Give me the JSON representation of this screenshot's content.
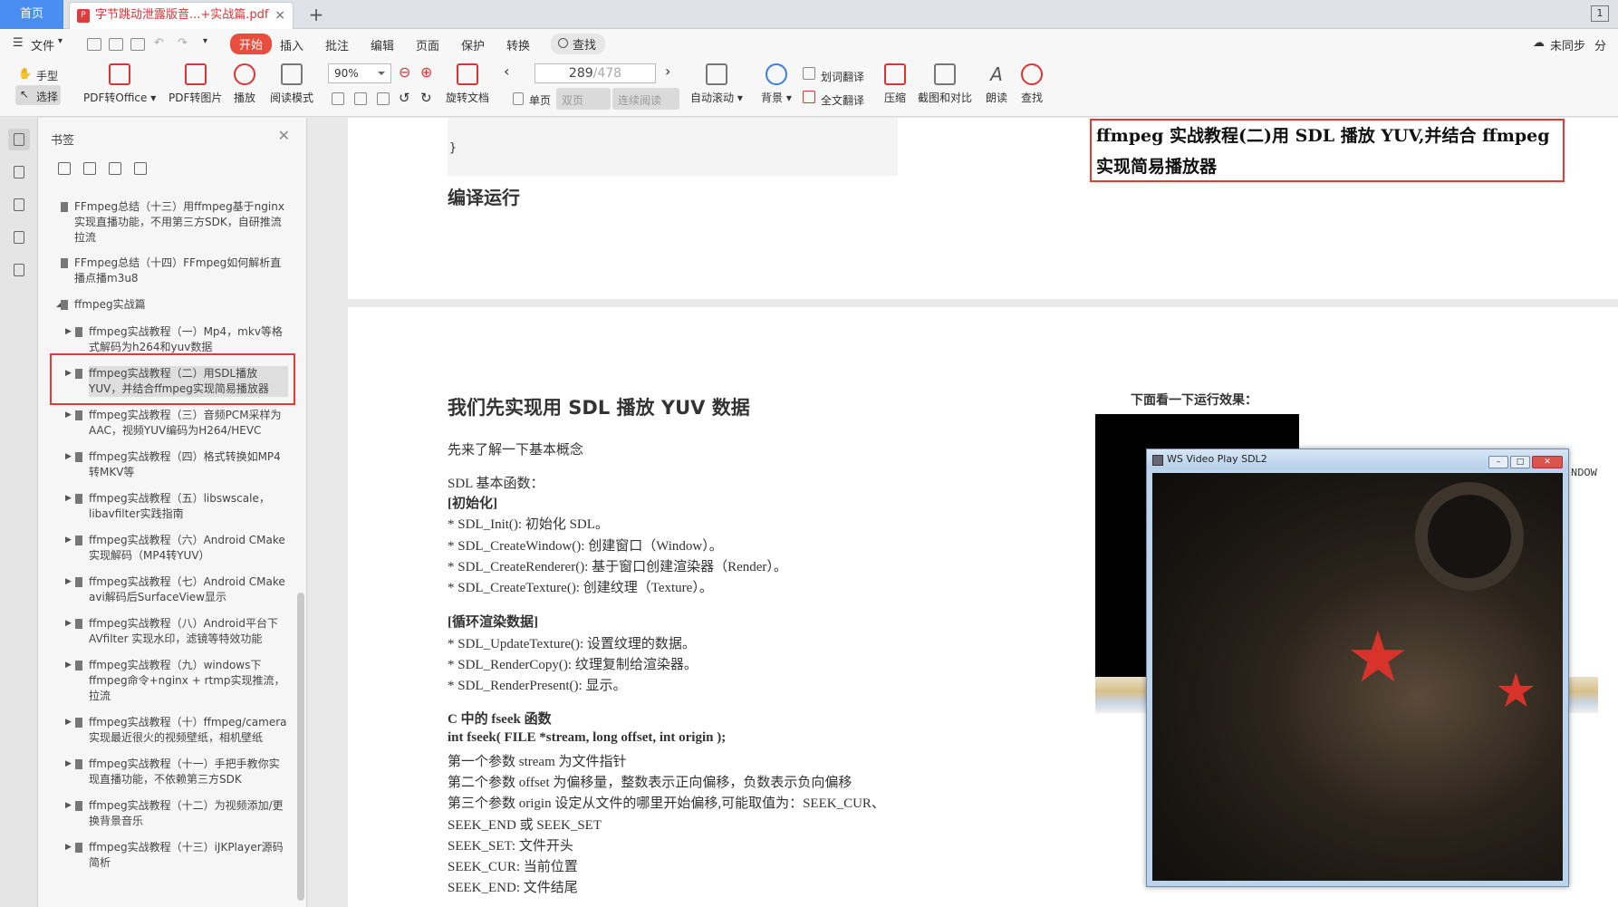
{
  "tabs": {
    "home": "首页",
    "doc": "字节跳动泄露版音...+实战篇.pdf"
  },
  "menu": [
    "文件",
    "开始",
    "插入",
    "批注",
    "编辑",
    "页面",
    "保护",
    "转换",
    "查找"
  ],
  "sync": {
    "unsynced": "未同步",
    "share": "分"
  },
  "tools": {
    "hand": "手型",
    "select": "选择",
    "pdf2office": "PDF转Office",
    "pdf2img": "PDF转图片",
    "play": "播放",
    "readmode": "阅读模式",
    "zoom": "90%",
    "rotate": "旋转文档",
    "page_current": "289",
    "page_total": "/478",
    "single": "单页",
    "double": "双页",
    "continuous": "连续阅读",
    "autoscroll": "自动滚动",
    "background": "背景",
    "word_translate": "划词翻译",
    "full_translate": "全文翻译",
    "compress": "压缩",
    "screenshot_compare": "截图和对比",
    "read_aloud": "朗读",
    "find": "查找"
  },
  "bookmarks_panel": {
    "title": "书签",
    "items": [
      "FFmpeg总结（十三）用ffmpeg基于nginx实现直播功能，不用第三方SDK，自研推流拉流",
      "FFmpeg总结（十四）FFmpeg如何解析直播点播m3u8",
      "ffmpeg实战篇",
      "ffmpeg实战教程（一）Mp4，mkv等格式解码为h264和yuv数据",
      "ffmpeg实战教程（二）用SDL播放YUV，并结合ffmpeg实现简易播放器",
      "ffmpeg实战教程（三）音频PCM采样为AAC，视频YUV编码为H264/HEVC",
      "ffmpeg实战教程（四）格式转换如MP4转MKV等",
      "ffmpeg实战教程（五）libswscale，libavfilter实践指南",
      "ffmpeg实战教程（六）Android CMake实现解码（MP4转YUV）",
      "ffmpeg实战教程（七）Android CMake avi解码后SurfaceView显示",
      "ffmpeg实战教程（八）Android平台下AVfilter 实现水印，滤镜等特效功能",
      "ffmpeg实战教程（九）windows下ffmpeg命令+nginx + rtmp实现推流，拉流",
      "ffmpeg实战教程（十）ffmpeg/camera实现最近很火的视频壁纸，相机壁纸",
      "ffmpeg实战教程（十一）手把手教你实现直播功能，不依赖第三方SDK",
      "ffmpeg实战教程（十二）为视频添加/更换背景音乐",
      "ffmpeg实战教程（十三）iJKPlayer源码简析"
    ]
  },
  "document": {
    "code_tail": "}",
    "heading_compile": "编译运行",
    "right_title": "ffmpeg 实战教程(二)用 SDL 播放 YUV,并结合 ffmpeg 实现简易播放器",
    "heading_sdl": "我们先实现用 SDL 播放 YUV 数据",
    "lines": [
      "先来了解一下基本概念",
      "SDL 基本函数：",
      "[初始化]",
      "* SDL_Init(): 初始化 SDL。",
      "* SDL_CreateWindow(): 创建窗口（Window）。",
      "* SDL_CreateRenderer(): 基于窗口创建渲染器（Render）。",
      "* SDL_CreateTexture(): 创建纹理（Texture）。",
      "[循环渲染数据]",
      "* SDL_UpdateTexture(): 设置纹理的数据。",
      "* SDL_RenderCopy(): 纹理复制给渲染器。",
      "* SDL_RenderPresent(): 显示。",
      "C 中的 fseek 函数",
      "int fseek( FILE *stream, long offset, int origin );",
      "第一个参数 stream 为文件指针",
      "第二个参数 offset 为偏移量，整数表示正向偏移，负数表示负向偏移",
      "第三个参数 origin 设定从文件的哪里开始偏移,可能取值为：SEEK_CUR、",
      "SEEK_END 或 SEEK_SET",
      "SEEK_SET:   文件开头",
      "SEEK_CUR:   当前位置",
      "SEEK_END:   文件结尾"
    ],
    "effect_label": "下面看一下运行效果：",
    "sdl_window_title": "WS Video Play SDL2",
    "ndow": "NDOW"
  }
}
